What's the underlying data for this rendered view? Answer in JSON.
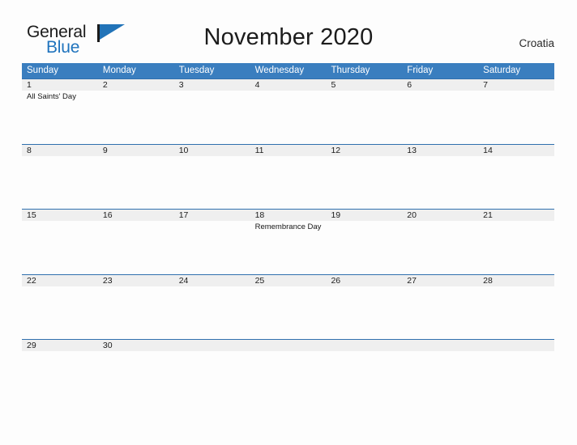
{
  "brand": {
    "line1": "General",
    "line2": "Blue",
    "flag_icon": "flag-triangle-icon",
    "accent_color": "#2173b8"
  },
  "header": {
    "title": "November 2020",
    "region": "Croatia"
  },
  "colors": {
    "header_blue": "#3a7ebf",
    "row_divider_blue": "#2f6fae",
    "date_band_gray": "#efefef",
    "page_background": "#fdfdfd",
    "text": "#1c1c1c"
  },
  "calendar": {
    "month": "November",
    "year": "2020",
    "weekday_headers": [
      "Sunday",
      "Monday",
      "Tuesday",
      "Wednesday",
      "Thursday",
      "Friday",
      "Saturday"
    ],
    "weeks": [
      {
        "days": [
          {
            "date": "1",
            "event": "All Saints' Day"
          },
          {
            "date": "2",
            "event": ""
          },
          {
            "date": "3",
            "event": ""
          },
          {
            "date": "4",
            "event": ""
          },
          {
            "date": "5",
            "event": ""
          },
          {
            "date": "6",
            "event": ""
          },
          {
            "date": "7",
            "event": ""
          }
        ]
      },
      {
        "days": [
          {
            "date": "8",
            "event": ""
          },
          {
            "date": "9",
            "event": ""
          },
          {
            "date": "10",
            "event": ""
          },
          {
            "date": "11",
            "event": ""
          },
          {
            "date": "12",
            "event": ""
          },
          {
            "date": "13",
            "event": ""
          },
          {
            "date": "14",
            "event": ""
          }
        ]
      },
      {
        "days": [
          {
            "date": "15",
            "event": ""
          },
          {
            "date": "16",
            "event": ""
          },
          {
            "date": "17",
            "event": ""
          },
          {
            "date": "18",
            "event": "Remembrance Day"
          },
          {
            "date": "19",
            "event": ""
          },
          {
            "date": "20",
            "event": ""
          },
          {
            "date": "21",
            "event": ""
          }
        ]
      },
      {
        "days": [
          {
            "date": "22",
            "event": ""
          },
          {
            "date": "23",
            "event": ""
          },
          {
            "date": "24",
            "event": ""
          },
          {
            "date": "25",
            "event": ""
          },
          {
            "date": "26",
            "event": ""
          },
          {
            "date": "27",
            "event": ""
          },
          {
            "date": "28",
            "event": ""
          }
        ]
      },
      {
        "days": [
          {
            "date": "29",
            "event": ""
          },
          {
            "date": "30",
            "event": ""
          },
          {
            "date": "",
            "event": ""
          },
          {
            "date": "",
            "event": ""
          },
          {
            "date": "",
            "event": ""
          },
          {
            "date": "",
            "event": ""
          },
          {
            "date": "",
            "event": ""
          }
        ]
      }
    ]
  }
}
